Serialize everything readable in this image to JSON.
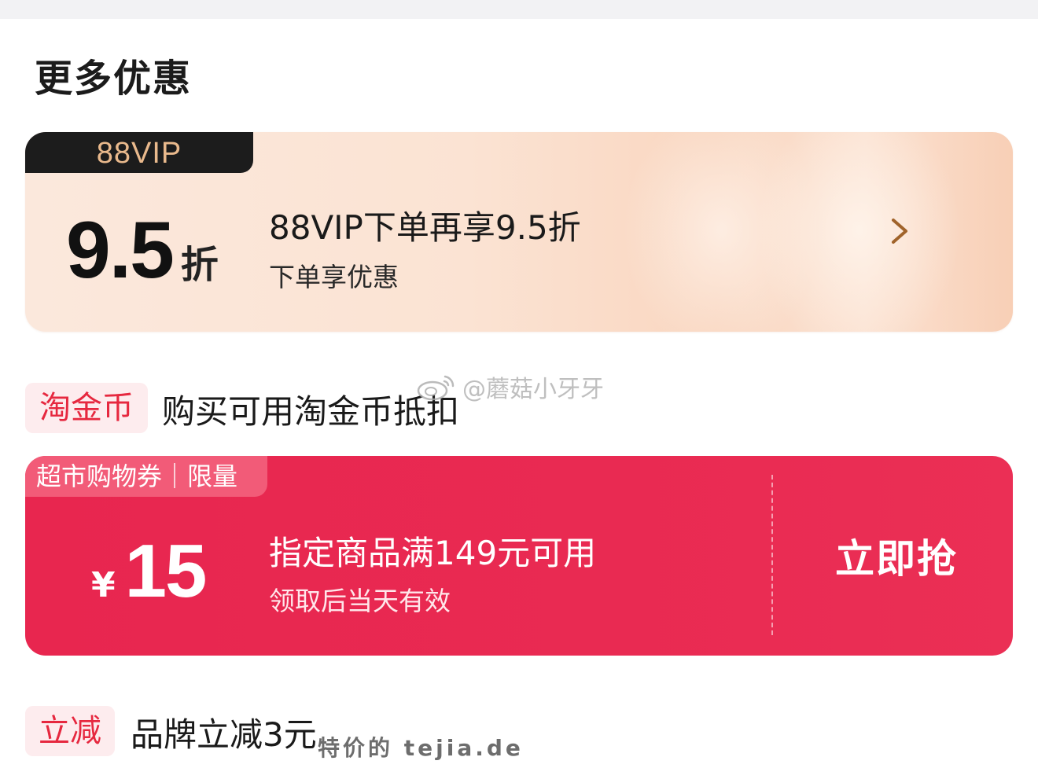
{
  "section_title": "更多优惠",
  "vip": {
    "badge": "88VIP",
    "value": "9.5",
    "unit": "折",
    "title": "88VIP下单再享9.5折",
    "subtitle": "下单享优惠",
    "chevron_icon": "chevron-right-icon"
  },
  "coin": {
    "tag": "淘金币",
    "text": "购买可用淘金币抵扣"
  },
  "watermark": {
    "icon": "weibo-icon",
    "text": "@蘑菇小牙牙"
  },
  "coupon": {
    "badge": "超市购物券｜限量",
    "currency": "¥",
    "value": "15",
    "title": "指定商品满149元可用",
    "subtitle": "领取后当天有效",
    "cta": "立即抢"
  },
  "reduce": {
    "tag": "立减",
    "text": "品牌立减3元"
  },
  "site_mark": "特价的 tejia.de",
  "colors": {
    "accent_red": "#e8264f",
    "tag_red": "#e6283f",
    "vip_gold": "#e9b98c"
  }
}
